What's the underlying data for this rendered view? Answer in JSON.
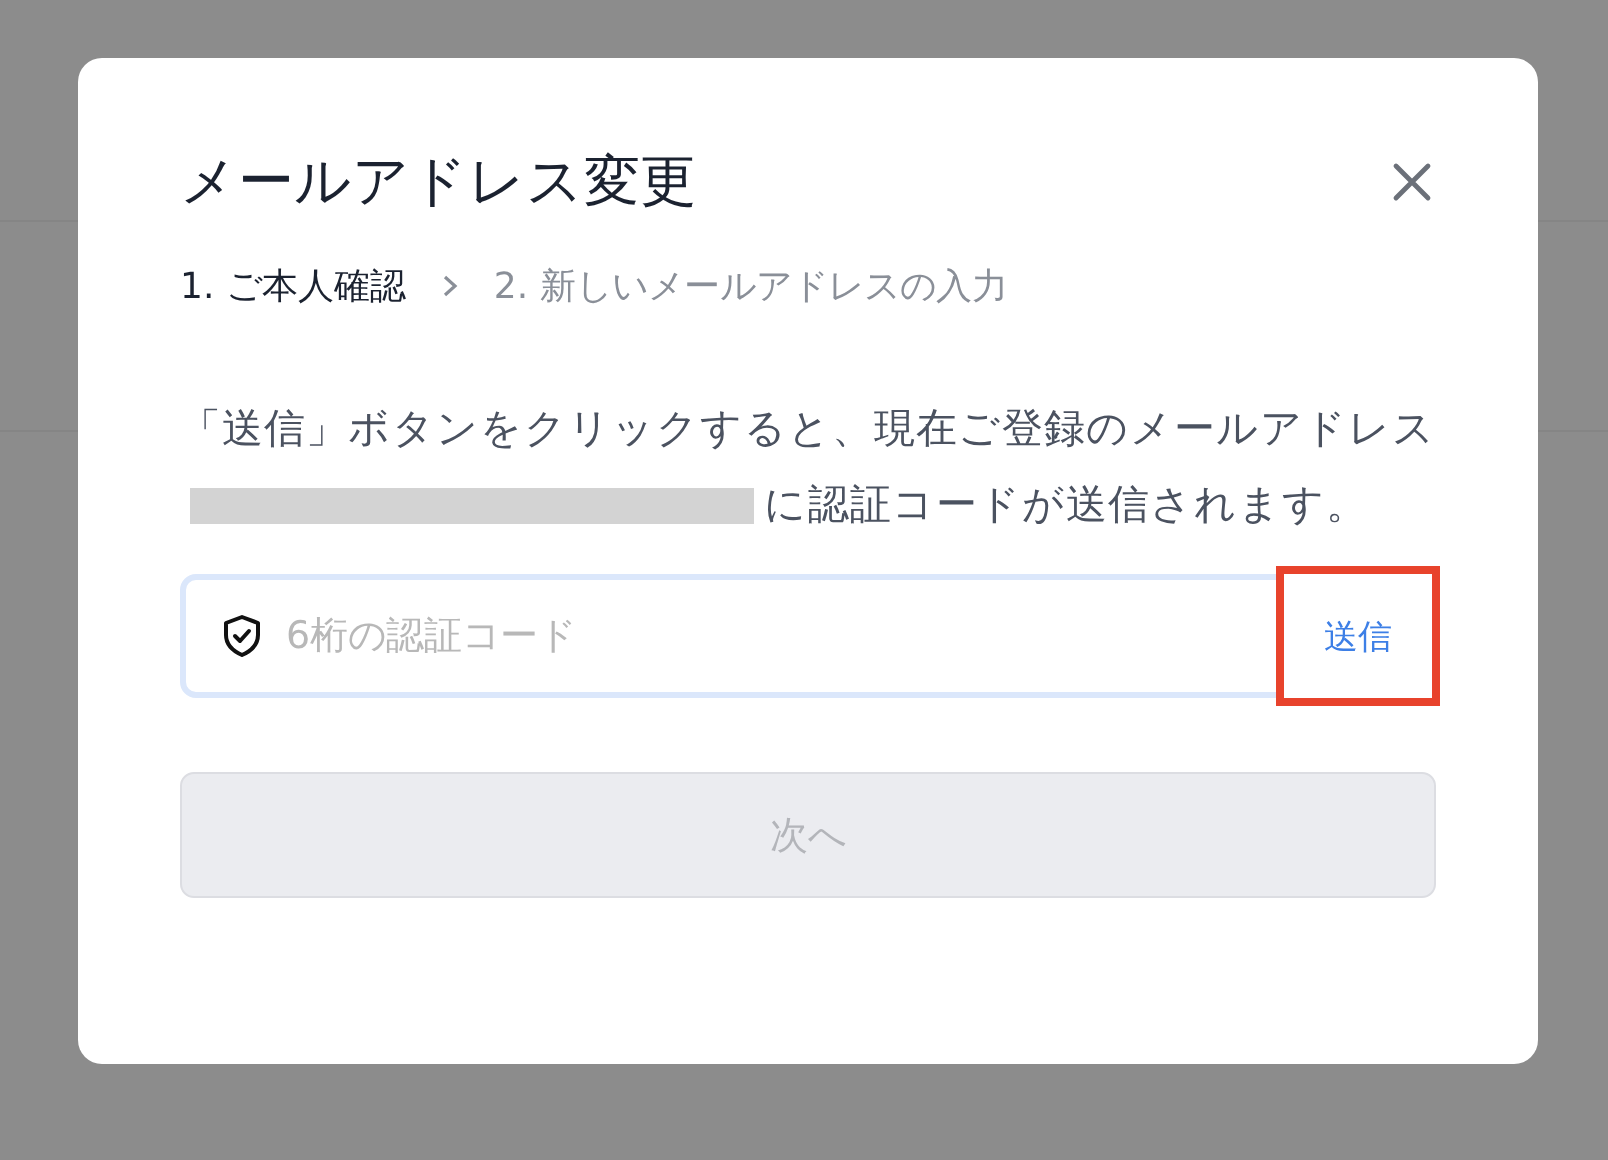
{
  "dialog": {
    "title": "メールアドレス変更",
    "steps": [
      {
        "label": "1. ご本人確認",
        "selected": true
      },
      {
        "label": "2. 新しいメールアドレスの入力",
        "selected": false
      }
    ],
    "message": {
      "before": "「送信」ボタンをクリックすると、現在ご登録のメールアドレス",
      "redacted": true,
      "after": "に認証コードが送信されます。"
    },
    "code_field": {
      "placeholder": "6桁の認証コード",
      "send_button": {
        "label": "送信",
        "highlighted": true
      }
    },
    "next_button": {
      "label": "次へ",
      "disabled": true
    }
  }
}
